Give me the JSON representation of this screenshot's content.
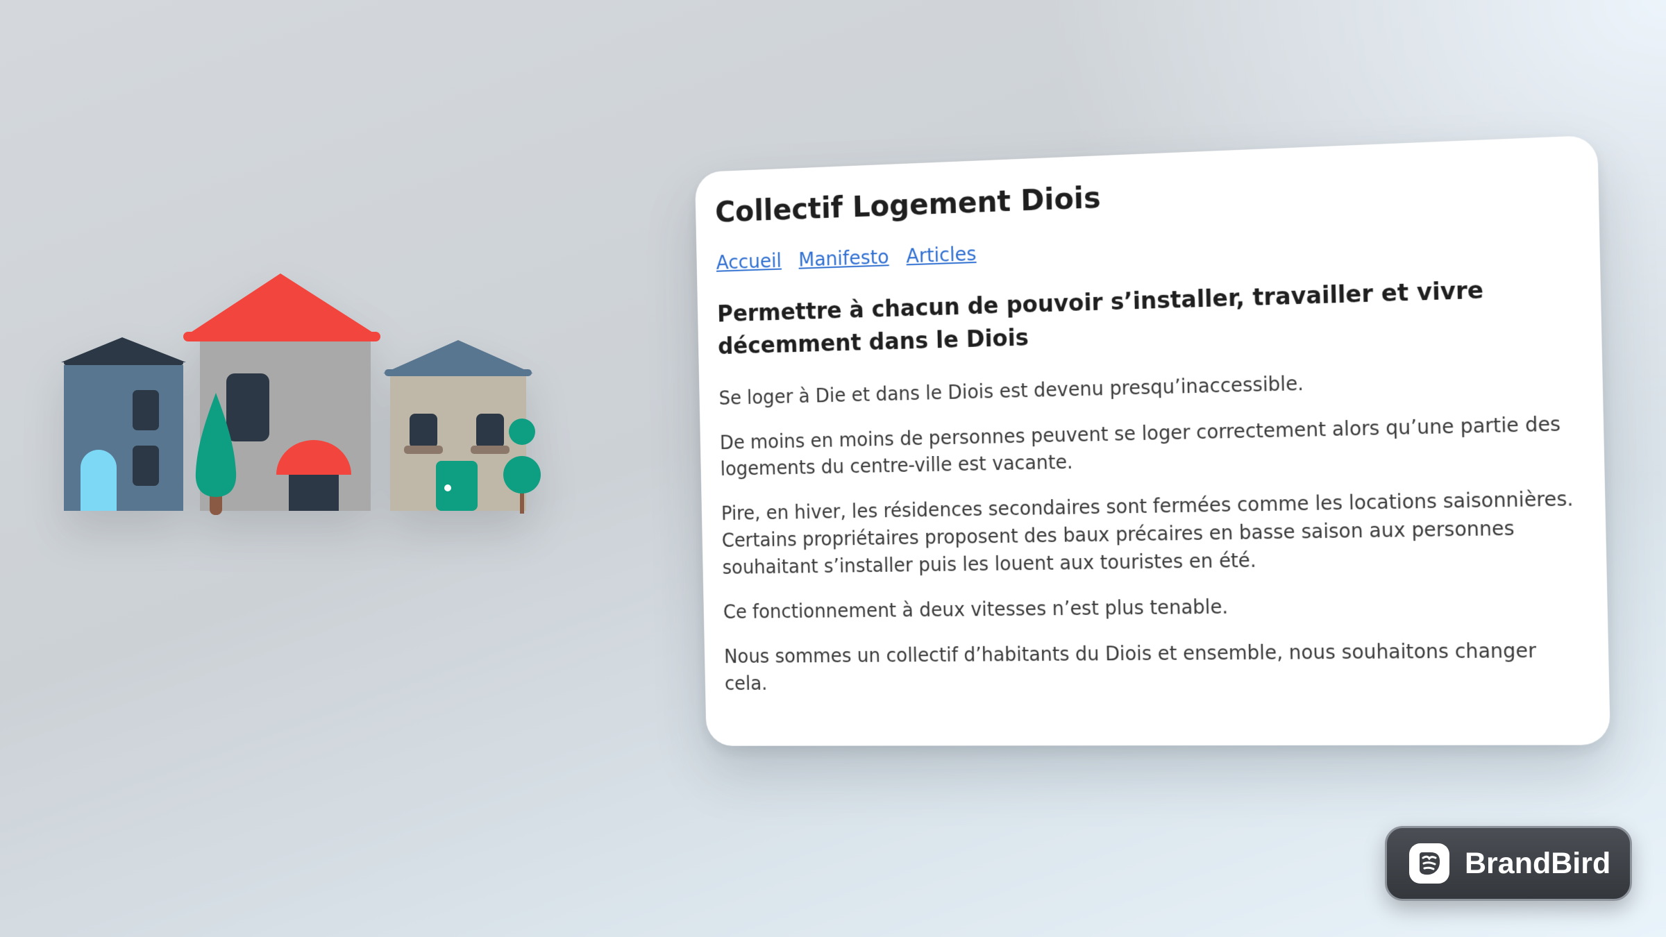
{
  "site": {
    "title": "Collectif Logement Diois",
    "nav": [
      {
        "label": "Accueil"
      },
      {
        "label": "Manifesto"
      },
      {
        "label": "Articles"
      }
    ],
    "heading": "Permettre à chacun de pouvoir s’installer, travailler et vivre décemment dans le Diois",
    "paragraphs": [
      "Se loger à Die et dans le Diois est devenu presqu’inaccessible.",
      "De moins en moins de personnes peuvent se loger correctement alors qu’une partie des logements du centre-ville est vacante.",
      "Pire, en hiver, les résidences secondaires sont fermées comme les locations saisonnières. Certains propriétaires proposent des baux précaires en basse saison aux personnes souhaitant s’installer puis les louent aux touristes en été.",
      "Ce fonctionnement à deux vitesses n’est plus tenable.",
      "Nous sommes un collectif d’habitants du Diois et ensemble, nous souhaitons changer cela."
    ]
  },
  "illustration": {
    "icon": "houses-illustration",
    "colors": {
      "red_roof": "#f2453d",
      "tall_house": "#a9a9a9",
      "blue_house": "#587690",
      "dark": "#2c3845",
      "beige_house": "#bfb8a8",
      "green": "#0e9f82",
      "sky_door": "#7dd8f5",
      "trunk": "#8a5a44"
    }
  },
  "watermark": {
    "label": "BrandBird",
    "icon": "brandbird-logo-icon"
  },
  "colors": {
    "link": "#2f6fd0",
    "card_background": "#ffffff",
    "badge_background": "#3d4146"
  }
}
